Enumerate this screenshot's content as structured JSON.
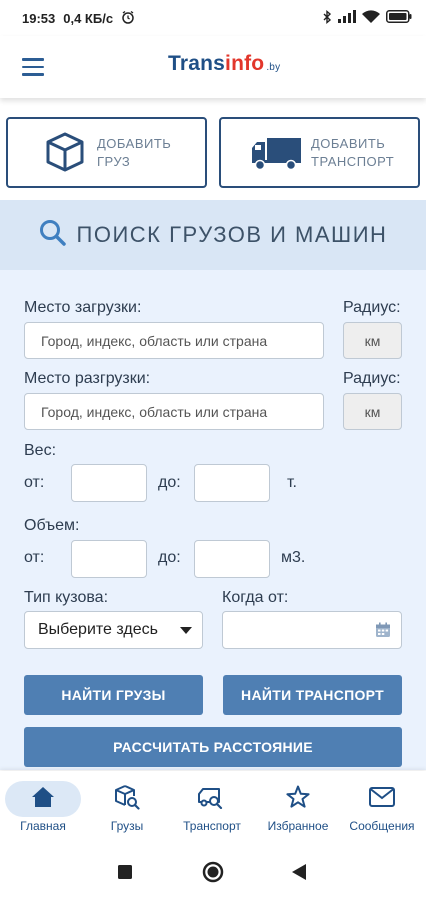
{
  "status": {
    "time": "19:53",
    "speed": "0,4 КБ/с"
  },
  "header": {
    "logo_trans": "Trans",
    "logo_info": "info",
    "logo_domain": ".by"
  },
  "actions": {
    "add_cargo": {
      "line1": "ДОБАВИТЬ",
      "line2": "ГРУЗ"
    },
    "add_transport": {
      "line1": "ДОБАВИТЬ",
      "line2": "ТРАНСПОРТ"
    }
  },
  "search": {
    "title": "ПОИСК ГРУЗОВ И МАШИН",
    "loading_label": "Место загрузки:",
    "loading_placeholder": "Город, индекс, область или страна",
    "unloading_label": "Место разгрузки:",
    "unloading_placeholder": "Город, индекс, область или страна",
    "radius_label": "Радиус:",
    "radius_unit": "км",
    "weight_label": "Вес:",
    "volume_label": "Объем:",
    "from": "от:",
    "to": "до:",
    "weight_unit": "т.",
    "volume_unit": "м3.",
    "body_type_label": "Тип кузова:",
    "body_type_value": "Выберите здесь",
    "when_label": "Когда от:",
    "find_cargo": "НАЙТИ ГРУЗЫ",
    "find_transport": "НАЙТИ ТРАНСПОРТ",
    "calc_distance": "РАССЧИТАТЬ РАССТОЯНИЕ"
  },
  "bottom_nav": {
    "items": [
      {
        "label": "Главная",
        "icon": "home-icon",
        "active": true
      },
      {
        "label": "Грузы",
        "icon": "cargo-search-icon"
      },
      {
        "label": "Транспорт",
        "icon": "transport-search-icon"
      },
      {
        "label": "Избранное",
        "icon": "star-icon"
      },
      {
        "label": "Сообщения",
        "icon": "mail-icon"
      }
    ]
  },
  "colors": {
    "primary": "#1f4f86",
    "accent_red": "#e2362b",
    "button": "#4f7fb3",
    "banner": "#d9e6f5",
    "form_bg": "#eaf2fd"
  }
}
